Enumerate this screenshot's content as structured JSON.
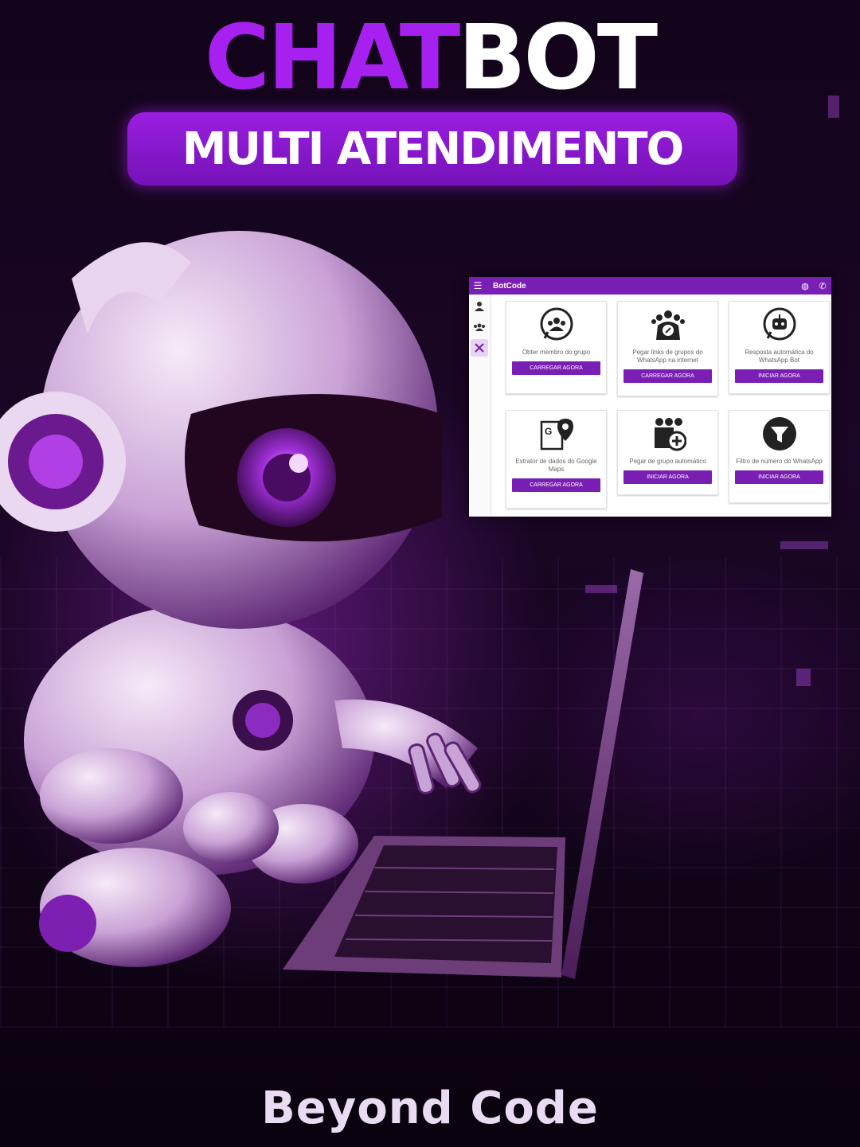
{
  "headline": {
    "part1": "CHAT",
    "part2": "BOT",
    "subtitle": "MULTI ATENDIMENTO"
  },
  "app": {
    "title": "BotCode",
    "menu_icon": "hamburger-icon",
    "header_icons": [
      "globe-icon",
      "whatsapp-icon"
    ],
    "sidebar_icons": [
      "user-icon",
      "users-icon",
      "tools-icon"
    ],
    "cards": [
      {
        "label": "Obter membro do grupo",
        "button": "CARREGAR AGORA",
        "icon": "group-chat-icon"
      },
      {
        "label": "Pegar links de grupos do WhatsApp na internet",
        "button": "CARREGAR AGORA",
        "icon": "group-link-icon"
      },
      {
        "label": "Resposta automática do WhatsApp Bot",
        "button": "INICIAR AGORA",
        "icon": "bot-chat-icon"
      },
      {
        "label": "Extrator de dados do Google Maps",
        "button": "CARREGAR AGORA",
        "icon": "google-maps-icon"
      },
      {
        "label": "Pegar de grupo automático",
        "button": "INICIAR AGORA",
        "icon": "group-add-icon"
      },
      {
        "label": "Filtro de número do WhatsApp",
        "button": "INICIAR AGORA",
        "icon": "filter-icon"
      }
    ]
  },
  "brand": "Beyond Code",
  "colors": {
    "accent": "#7a1fb3",
    "title_purple": "#a621f0",
    "background": "#0b030f"
  }
}
